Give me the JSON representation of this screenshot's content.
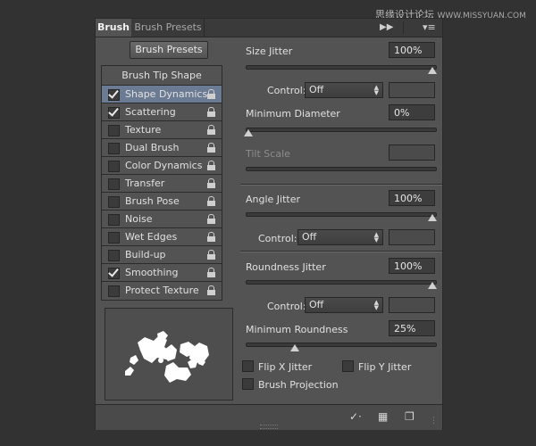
{
  "watermark": {
    "text": "思缘设计论坛",
    "url": "WWW.MISSYUAN.COM"
  },
  "tabs": {
    "active": "Brush",
    "inactive": "Brush Presets"
  },
  "panel": {
    "brush_presets_button": "Brush Presets",
    "brush_tip_shape": "Brush Tip Shape",
    "options": [
      {
        "label": "Shape Dynamics",
        "checked": true,
        "selected": true
      },
      {
        "label": "Scattering",
        "checked": true,
        "selected": false
      },
      {
        "label": "Texture",
        "checked": false,
        "selected": false
      },
      {
        "label": "Dual Brush",
        "checked": false,
        "selected": false
      },
      {
        "label": "Color Dynamics",
        "checked": false,
        "selected": false
      },
      {
        "label": "Transfer",
        "checked": false,
        "selected": false
      },
      {
        "label": "Brush Pose",
        "checked": false,
        "selected": false
      },
      {
        "label": "Noise",
        "checked": false,
        "selected": false
      },
      {
        "label": "Wet Edges",
        "checked": false,
        "selected": false
      },
      {
        "label": "Build-up",
        "checked": false,
        "selected": false
      },
      {
        "label": "Smoothing",
        "checked": true,
        "selected": false
      },
      {
        "label": "Protect Texture",
        "checked": false,
        "selected": false
      }
    ]
  },
  "settings": {
    "size_jitter": {
      "label": "Size Jitter",
      "value": "100%",
      "level": 1.0
    },
    "control1": {
      "label": "Control:",
      "value": "Off"
    },
    "min_diameter": {
      "label": "Minimum Diameter",
      "value": "0%",
      "level": 0.0
    },
    "tilt_scale": {
      "label": "Tilt Scale"
    },
    "angle_jitter": {
      "label": "Angle Jitter",
      "value": "100%",
      "level": 1.0
    },
    "control2": {
      "label": "Control:",
      "value": "Off"
    },
    "roundness_jitter": {
      "label": "Roundness Jitter",
      "value": "100%",
      "level": 1.0
    },
    "control3": {
      "label": "Control:",
      "value": "Off"
    },
    "min_roundness": {
      "label": "Minimum Roundness",
      "value": "25%",
      "level": 0.25
    },
    "flip_x": {
      "label": "Flip X Jitter",
      "checked": false
    },
    "flip_y": {
      "label": "Flip Y Jitter",
      "checked": false
    },
    "brush_projection": {
      "label": "Brush Projection",
      "checked": false
    }
  },
  "icons": [
    "fast-forward-icon",
    "panel-menu-icon",
    "lock-icon",
    "brush-toggle-icon",
    "grid-icon",
    "new-preset-icon",
    "resize-grip-icon"
  ],
  "colors": {
    "panel": "#535353",
    "selected_row": "#6b7b93",
    "background": "#323232"
  }
}
